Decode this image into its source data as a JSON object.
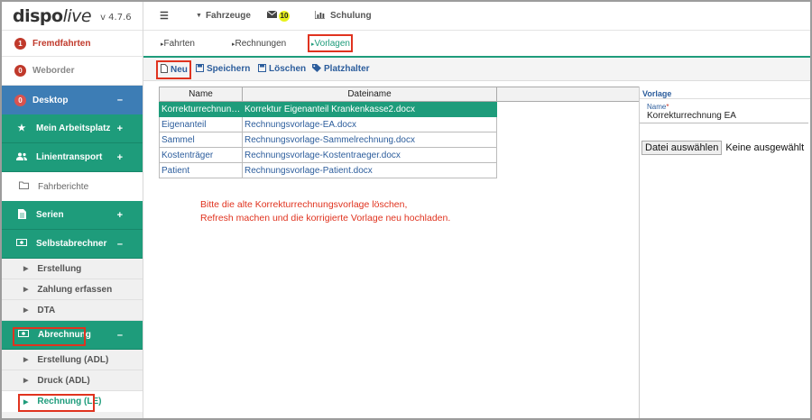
{
  "app": {
    "brand_main": "dispo",
    "brand_italic": "live",
    "version": "v 4.7.6"
  },
  "sidebar": {
    "items": [
      {
        "label": "Fremdfahrten",
        "badge": "1"
      },
      {
        "label": "Weborder",
        "badge": "0"
      },
      {
        "label": "Desktop",
        "badge": "0",
        "toggle": "–"
      },
      {
        "label": "Mein Arbeitsplatz",
        "toggle": "+"
      },
      {
        "label": "Linientransport",
        "toggle": "+"
      },
      {
        "label": "Fahrberichte"
      },
      {
        "label": "Serien",
        "toggle": "+"
      },
      {
        "label": "Selbstabrechner",
        "toggle": "–"
      },
      {
        "label": "Erstellung"
      },
      {
        "label": "Zahlung erfassen"
      },
      {
        "label": "DTA"
      },
      {
        "label": "Abrechnung",
        "toggle": "–"
      },
      {
        "label": "Erstellung (ADL)"
      },
      {
        "label": "Druck (ADL)"
      },
      {
        "label": "Rechnung (LE)"
      }
    ]
  },
  "topbar": {
    "vehicles": "Fahrzeuge",
    "mail_count": "10",
    "training": "Schulung"
  },
  "tabs": [
    "Fahrten",
    "Rechnungen",
    "Vorlagen"
  ],
  "toolbar": {
    "new": "Neu",
    "save": "Speichern",
    "delete": "Löschen",
    "placeholder": "Platzhalter"
  },
  "grid": {
    "columns": [
      "Name",
      "Dateiname"
    ],
    "rows": [
      [
        "Korrekturrechnun…",
        "Korrektur Eigenanteil Krankenkasse2.docx"
      ],
      [
        "Eigenanteil",
        "Rechnungsvorlage-EA.docx"
      ],
      [
        "Sammel",
        "Rechnungsvorlage-Sammelrechnung.docx"
      ],
      [
        "Kostenträger",
        "Rechnungsvorlage-Kostentraeger.docx"
      ],
      [
        "Patient",
        "Rechnungsvorlage-Patient.docx"
      ]
    ]
  },
  "note": {
    "line1": "Bitte die alte Korrekturrechnungsvorlage löschen,",
    "line2": "Refresh machen und die korrigierte Vorlage neu hochladen."
  },
  "panel": {
    "title": "Vorlage",
    "name_label": "Name",
    "required_mark": "*",
    "name_value": "Korrekturrechnung EA",
    "file_button": "Datei auswählen",
    "file_status": "Keine ausgewählt"
  },
  "colors": {
    "accent_green": "#1e9c7b",
    "desktop_blue": "#3d7db5",
    "annotation_red": "#e0331f",
    "link_blue": "#2c5d9c"
  }
}
